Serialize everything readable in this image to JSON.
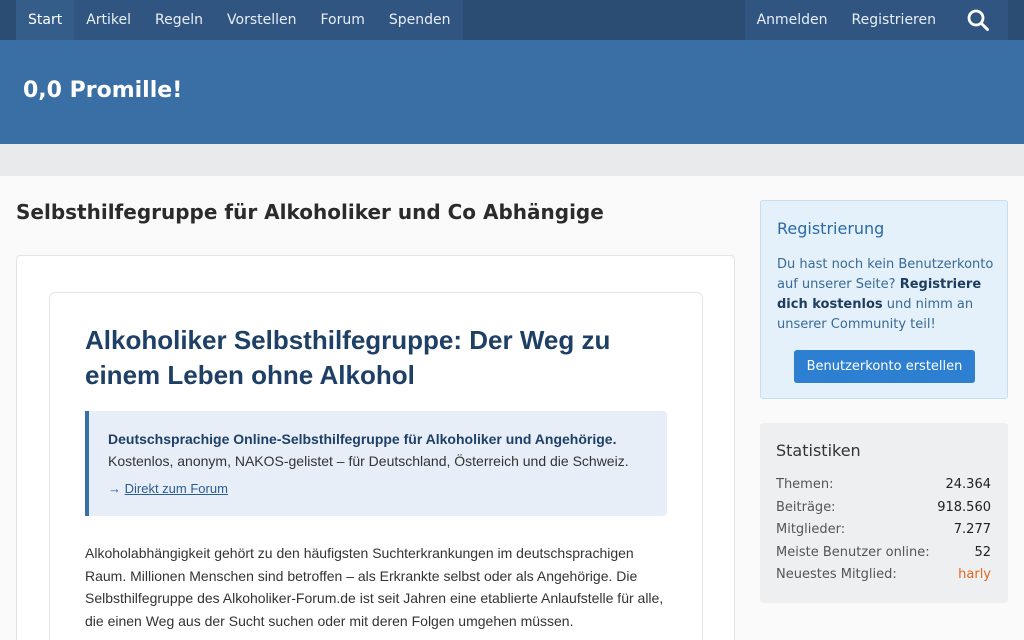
{
  "nav": {
    "left": [
      "Start",
      "Artikel",
      "Regeln",
      "Vorstellen",
      "Forum",
      "Spenden"
    ],
    "right": [
      "Anmelden",
      "Registrieren"
    ]
  },
  "site": {
    "title": "0,0 Promille!"
  },
  "page": {
    "title": "Selbsthilfegruppe für Alkoholiker und Co Abhängige"
  },
  "article": {
    "title": "Alkoholiker Selbsthilfegruppe: Der Weg zu einem Leben ohne Alkohol",
    "callout_strong": "Deutschsprachige Online-Selbsthilfegruppe für Alkoholiker und Angehörige.",
    "callout_text": "Kostenlos, anonym, NAKOS-gelistet – für Deutschland, Österreich und die Schweiz.",
    "callout_arrow": "→",
    "callout_link": "Direkt zum Forum",
    "intro": "Alkoholabhängigkeit gehört zu den häufigsten Suchterkrankungen im deutschsprachigen Raum. Millionen Menschen sind betroffen – als Erkrankte selbst oder als Angehörige. Die Selbsthilfegruppe des Alkoholiker-Forum.de ist seit Jahren eine etablierte Anlaufstelle für alle, die einen Weg aus der Sucht suchen oder mit deren Folgen umgehen müssen."
  },
  "registration": {
    "title": "Registrierung",
    "text_1": "Du hast noch kein Benutzerkonto auf unserer Seite? ",
    "text_strong": "Registriere dich kostenlos",
    "text_2": " und nimm an unserer Community teil!",
    "button": "Benutzerkonto erstellen"
  },
  "stats": {
    "title": "Statistiken",
    "rows": [
      {
        "label": "Themen:",
        "value": "24.364"
      },
      {
        "label": "Beiträge:",
        "value": "918.560"
      },
      {
        "label": "Mitglieder:",
        "value": "7.277"
      },
      {
        "label": "Meiste Benutzer online:",
        "value": "52"
      },
      {
        "label": "Neuestes Mitglied:",
        "value": "harly"
      }
    ]
  },
  "colors": {
    "nav": "#2b4d73",
    "banner": "#3a6fa5",
    "accent": "#2d7fd1",
    "newest_member": "#e06820"
  },
  "icons": {
    "search": "search-icon",
    "arrow": "arrow-right-icon"
  }
}
